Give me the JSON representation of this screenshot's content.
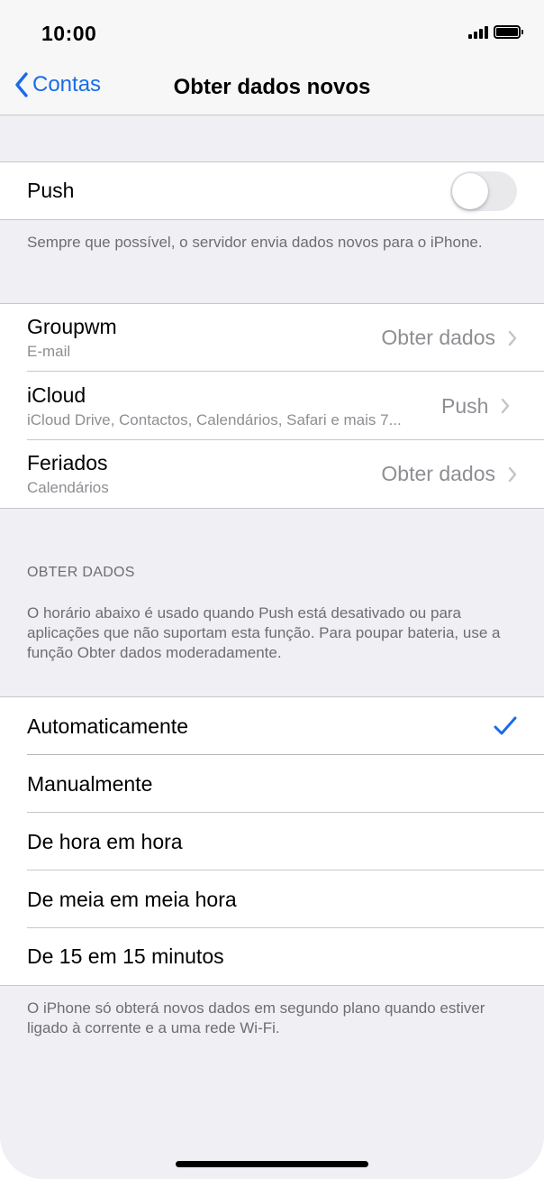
{
  "status_bar": {
    "time": "10:00"
  },
  "nav": {
    "back_label": "Contas",
    "title": "Obter dados novos"
  },
  "push": {
    "label": "Push",
    "enabled": false,
    "footer": "Sempre que possível, o servidor envia dados novos para o iPhone."
  },
  "accounts": [
    {
      "name": "Groupwm",
      "detail": "E-mail",
      "value": "Obter dados"
    },
    {
      "name": "iCloud",
      "detail": "iCloud Drive, Contactos, Calendários, Safari e mais 7...",
      "value": "Push"
    },
    {
      "name": "Feriados",
      "detail": "Calendários",
      "value": "Obter dados"
    }
  ],
  "fetch": {
    "header": "OBTER DADOS",
    "description": "O horário abaixo é usado quando Push está desativado ou para aplicações que não suportam esta função. Para poupar bateria, use a função Obter dados moderadamente.",
    "options": [
      {
        "label": "Automaticamente",
        "selected": true
      },
      {
        "label": "Manualmente",
        "selected": false
      },
      {
        "label": "De hora em hora",
        "selected": false
      },
      {
        "label": "De meia em meia hora",
        "selected": false
      },
      {
        "label": "De 15 em 15 minutos",
        "selected": false
      }
    ],
    "footer": "O iPhone só obterá novos dados em segundo plano quando estiver ligado à corrente e a uma rede Wi-Fi."
  },
  "colors": {
    "accent": "#1a6ce8",
    "secondary_text": "#8e8e93",
    "background": "#efeff4",
    "separator": "#c8c7cc"
  },
  "icons": {
    "back": "chevron-left-icon",
    "disclosure": "chevron-right-icon",
    "selected": "checkmark-icon"
  }
}
